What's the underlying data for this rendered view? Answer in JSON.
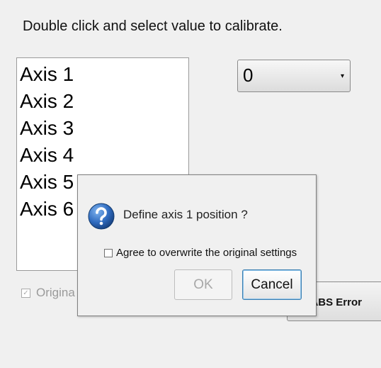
{
  "instruction": "Double click and select value to calibrate.",
  "axes": [
    "Axis 1",
    "Axis 2",
    "Axis 3",
    "Axis 4",
    "Axis 5",
    "Axis 6"
  ],
  "value_select": {
    "selected": "0",
    "arrow": "▾"
  },
  "original_checkbox": {
    "label": "Origina",
    "checked": true,
    "mark": "✓"
  },
  "abs_button_label": "r ABS Error",
  "dialog": {
    "question": "Define axis 1 position ?",
    "agree_label": "Agree to overwrite the original settings",
    "agree_checked": false,
    "ok_label": "OK",
    "cancel_label": "Cancel",
    "icon": "help-icon"
  },
  "colors": {
    "help_icon": "#2f6bbf",
    "focus_border": "#3c7fb1"
  }
}
